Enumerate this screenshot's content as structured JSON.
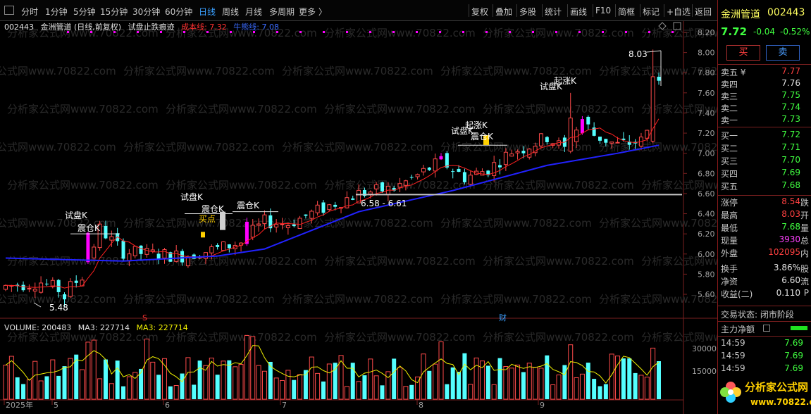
{
  "toolbar": {
    "left_tabs": [
      "分时",
      "1分钟",
      "5分钟",
      "15分钟",
      "30分钟",
      "60分钟",
      "日线",
      "周线",
      "月线",
      "多周期",
      "更多 〉"
    ],
    "active_tab": "日线",
    "right_tools": [
      "复权",
      "叠加",
      "多股",
      "统计",
      "画线",
      "F10",
      "简框",
      "标记",
      "+自选",
      "返回"
    ]
  },
  "info": {
    "code": "002443",
    "name_desc": "金洲管道 (日线,前复权)",
    "indicator": "试盘止跌痕迹",
    "cost_line": "成本线: 7.32",
    "bull_bear_line": "牛熊线: 7.08"
  },
  "volume_info": {
    "volume": "VOLUME: 200483",
    "ma3_a": "MA3: 227714",
    "ma3_b": "MA3: 227714"
  },
  "price_axis": [
    "8.20",
    "8.00",
    "7.80",
    "7.60",
    "7.40",
    "7.20",
    "7.00",
    "6.80",
    "6.60",
    "6.40",
    "6.20",
    "6.00",
    "5.80",
    "5.60"
  ],
  "volume_axis": [
    "30000",
    "15000"
  ],
  "time_axis": [
    "2025年",
    "5",
    "6",
    "7",
    "8",
    "9"
  ],
  "annotations": {
    "high_label": "8.03",
    "low_label": "5.48",
    "range_label": "6.58 - 6.61",
    "trial_1": "试盘K",
    "shake_1": "震仓K",
    "trial_2": "试盘K",
    "shake_2": "震仓K",
    "buy_point": "买点",
    "shake_3": "震仓K",
    "trial_3": "试盘K",
    "rise_1": "起涨K",
    "shake_4": "震仓K",
    "trial_4": "试盘K",
    "rise_2": "起涨K",
    "marker_s": "S",
    "marker_cai": "财"
  },
  "watermark": {
    "text": "分析家公式网www.70822.com",
    "logo_text": "分析家公式网",
    "logo_url": "www.70822.com"
  },
  "quote": {
    "name": "金洲管道",
    "code": "002443",
    "price": "7.72",
    "change": "-0.04",
    "pct": "-0.52%",
    "buy_btn": "买",
    "sell_btn": "卖",
    "asks": [
      {
        "label": "卖五 ¥",
        "price": "7.77"
      },
      {
        "label": "卖四",
        "price": "7.76"
      },
      {
        "label": "卖三",
        "price": "7.75"
      },
      {
        "label": "卖二",
        "price": "7.74"
      },
      {
        "label": "卖一",
        "price": "7.73"
      }
    ],
    "bids": [
      {
        "label": "买一",
        "price": "7.72"
      },
      {
        "label": "买二",
        "price": "7.71"
      },
      {
        "label": "买三",
        "price": "7.70"
      },
      {
        "label": "买四",
        "price": "7.69"
      },
      {
        "label": "买五",
        "price": "7.68"
      }
    ],
    "stats": [
      {
        "label": "涨停",
        "value": "8.54",
        "extra": "跌"
      },
      {
        "label": "最高",
        "value": "8.03",
        "extra": "开"
      },
      {
        "label": "最低",
        "value": "7.68",
        "extra": "量"
      },
      {
        "label": "现量",
        "value": "3930",
        "extra": "总"
      },
      {
        "label": "外盘",
        "value": "102095",
        "extra": "内"
      },
      {
        "label": "换手",
        "value": "3.86%",
        "extra": "股"
      },
      {
        "label": "净资",
        "value": "6.60",
        "extra": "流"
      },
      {
        "label": "收益(二)",
        "value": "0.110",
        "extra": "P"
      }
    ],
    "trade_status": "交易状态: 闭市阶段",
    "main_net": "主力净额",
    "ticks": [
      {
        "time": "14:59",
        "price": "7.69"
      },
      {
        "time": "14:59",
        "price": "7.69"
      },
      {
        "time": "14:59",
        "price": "7.69"
      }
    ]
  },
  "colors": {
    "up": "#ff4a4a",
    "down": "#54ffff",
    "ma_long": "#2222ff",
    "ma_short": "#ff2020",
    "volume_ma": "#f0f000",
    "magenta": "#ff00ff",
    "axis_text": "#a0a0a0"
  },
  "chart_data": {
    "type": "candlestick",
    "title": "金洲管道 (日线,前复权)",
    "ylim": [
      5.45,
      8.25
    ],
    "high": 8.03,
    "low": 5.48,
    "last_close": 7.72,
    "cost_line": 7.32,
    "bull_bear_line": 7.08,
    "volume_ylim": [
      0,
      38000
    ]
  }
}
